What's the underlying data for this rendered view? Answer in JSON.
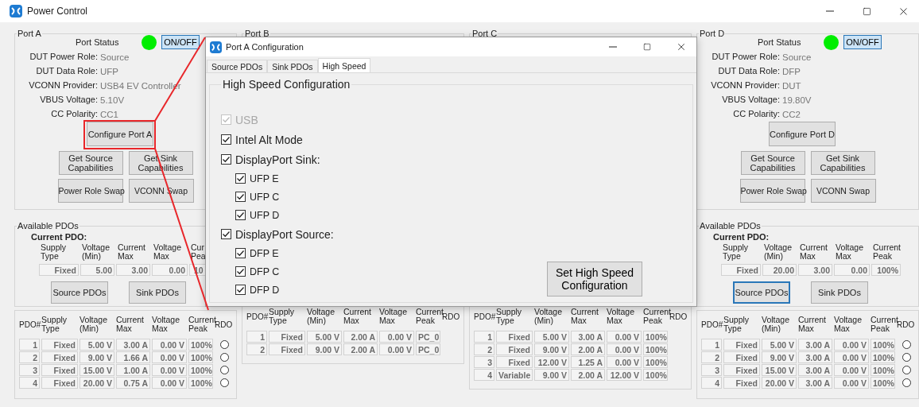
{
  "window": {
    "title": "Power Control"
  },
  "ports": [
    {
      "name": "Port A",
      "status": {
        "label": "Port Status",
        "on": true,
        "button": "ON/OFF"
      },
      "fields": [
        {
          "label": "DUT Power Role:",
          "value": "Source"
        },
        {
          "label": "DUT Data Role:",
          "value": "UFP"
        },
        {
          "label": "VCONN Provider:",
          "value": "USB4 EV Controller"
        },
        {
          "label": "VBUS Voltage:",
          "value": "5.10V"
        },
        {
          "label": "CC Polarity:",
          "value": "CC1"
        }
      ],
      "configure": "Configure Port A",
      "actions": [
        "Get Source\nCapabilities",
        "Get Sink\nCapabilities",
        "Power Role Swap",
        "VCONN Swap"
      ],
      "available": {
        "title": "Available PDOs",
        "current_title": "Current PDO:",
        "columns": [
          "Supply\nType",
          "Voltage\n(Min)",
          "Current\nMax",
          "Voltage\nMax",
          "Cur\nPea"
        ],
        "values": [
          "Fixed",
          "5.00",
          "3.00",
          "0.00",
          "10"
        ],
        "buttons": [
          {
            "label": "Source PDOs",
            "focused": false
          },
          {
            "label": "Sink PDOs",
            "focused": false
          }
        ]
      },
      "pdo_table": {
        "columns": [
          "PDO#",
          "Supply\nType",
          "Voltage\n(Min)",
          "Current\nMax",
          "Voltage\nMax",
          "Current\nPeak",
          "RDO"
        ],
        "rows": [
          {
            "cells": [
              "1",
              "Fixed",
              "5.00 V",
              "3.00 A",
              "0.00 V",
              "100%"
            ],
            "selected": false
          },
          {
            "cells": [
              "2",
              "Fixed",
              "9.00 V",
              "1.66 A",
              "0.00 V",
              "100%"
            ],
            "selected": false
          },
          {
            "cells": [
              "3",
              "Fixed",
              "15.00 V",
              "1.00 A",
              "0.00 V",
              "100%"
            ],
            "selected": false
          },
          {
            "cells": [
              "4",
              "Fixed",
              "20.00 V",
              "0.75 A",
              "0.00 V",
              "100%"
            ],
            "selected": false
          }
        ]
      }
    },
    {
      "name": "Port B",
      "pdo_table": {
        "columns": [
          "PDO#",
          "Supply\nType",
          "Voltage\n(Min)",
          "Current\nMax",
          "Voltage\nMax",
          "Current\nPeak",
          "RDO"
        ],
        "rows": [
          {
            "cells": [
              "1",
              "Fixed",
              "5.00 V",
              "2.00 A",
              "0.00 V",
              "PC_0"
            ]
          },
          {
            "cells": [
              "2",
              "Fixed",
              "9.00 V",
              "2.00 A",
              "0.00 V",
              "PC_0"
            ]
          }
        ]
      }
    },
    {
      "name": "Port C",
      "pdo_table": {
        "columns": [
          "PDO#",
          "Supply\nType",
          "Voltage\n(Min)",
          "Current\nMax",
          "Voltage\nMax",
          "Current\nPeak",
          "RDO"
        ],
        "rows": [
          {
            "cells": [
              "1",
              "Fixed",
              "5.00 V",
              "3.00 A",
              "0.00 V",
              "100%"
            ]
          },
          {
            "cells": [
              "2",
              "Fixed",
              "9.00 V",
              "2.00 A",
              "0.00 V",
              "100%"
            ]
          },
          {
            "cells": [
              "3",
              "Fixed",
              "12.00 V",
              "1.25 A",
              "0.00 V",
              "100%"
            ]
          },
          {
            "cells": [
              "4",
              "Variable",
              "9.00 V",
              "2.00 A",
              "12.00 V",
              "100%"
            ]
          }
        ]
      }
    },
    {
      "name": "Port D",
      "status": {
        "label": "Port Status",
        "on": true,
        "button": "ON/OFF"
      },
      "fields": [
        {
          "label": "DUT Power Role:",
          "value": "Source"
        },
        {
          "label": "DUT Data Role:",
          "value": "DFP"
        },
        {
          "label": "VCONN Provider:",
          "value": "DUT"
        },
        {
          "label": "VBUS Voltage:",
          "value": "19.80V"
        },
        {
          "label": "CC Polarity:",
          "value": "CC2"
        }
      ],
      "configure": "Configure Port D",
      "actions": [
        "Get Source\nCapabilities",
        "Get Sink\nCapabilities",
        "Power Role Swap",
        "VCONN Swap"
      ],
      "available": {
        "title": "Available PDOs",
        "current_title": "Current PDO:",
        "columns": [
          "Supply\nType",
          "Voltage\n(Min)",
          "Current\nMax",
          "Voltage\nMax",
          "Current\nPeak"
        ],
        "values": [
          "Fixed",
          "20.00",
          "3.00",
          "0.00",
          "100%"
        ],
        "buttons": [
          {
            "label": "Source PDOs",
            "focused": true
          },
          {
            "label": "Sink PDOs",
            "focused": false
          }
        ]
      },
      "pdo_table": {
        "columns": [
          "PDO#",
          "Supply\nType",
          "Voltage\n(Min)",
          "Current\nMax",
          "Voltage\nMax",
          "Current\nPeak",
          "RDO"
        ],
        "rows": [
          {
            "cells": [
              "1",
              "Fixed",
              "5.00 V",
              "3.00 A",
              "0.00 V",
              "100%"
            ],
            "selected": false
          },
          {
            "cells": [
              "2",
              "Fixed",
              "9.00 V",
              "3.00 A",
              "0.00 V",
              "100%"
            ],
            "selected": false
          },
          {
            "cells": [
              "3",
              "Fixed",
              "15.00 V",
              "3.00 A",
              "0.00 V",
              "100%"
            ],
            "selected": false
          },
          {
            "cells": [
              "4",
              "Fixed",
              "20.00 V",
              "3.00 A",
              "0.00 V",
              "100%"
            ],
            "selected": false
          }
        ]
      }
    }
  ],
  "dialog": {
    "title": "Port A Configuration",
    "tabs": [
      {
        "label": "Source PDOs",
        "selected": false
      },
      {
        "label": "Sink PDOs",
        "selected": false
      },
      {
        "label": "High Speed",
        "selected": true
      }
    ],
    "group_title": "High Speed Configuration",
    "options": [
      {
        "label": "USB",
        "checked": true,
        "disabled": true
      },
      {
        "label": "Intel Alt Mode",
        "checked": true,
        "disabled": false
      },
      {
        "label": "DisplayPort Sink:",
        "checked": true,
        "disabled": false,
        "children": [
          {
            "label": "UFP E",
            "checked": true,
            "disabled": false
          },
          {
            "label": "UFP C",
            "checked": true,
            "disabled": false
          },
          {
            "label": "UFP D",
            "checked": true,
            "disabled": false
          }
        ]
      },
      {
        "label": "DisplayPort Source:",
        "checked": true,
        "disabled": false,
        "children": [
          {
            "label": "DFP E",
            "checked": true,
            "disabled": false
          },
          {
            "label": "DFP C",
            "checked": true,
            "disabled": false
          },
          {
            "label": "DFP D",
            "checked": true,
            "disabled": false
          }
        ]
      }
    ],
    "button": "Set High Speed Configuration"
  }
}
